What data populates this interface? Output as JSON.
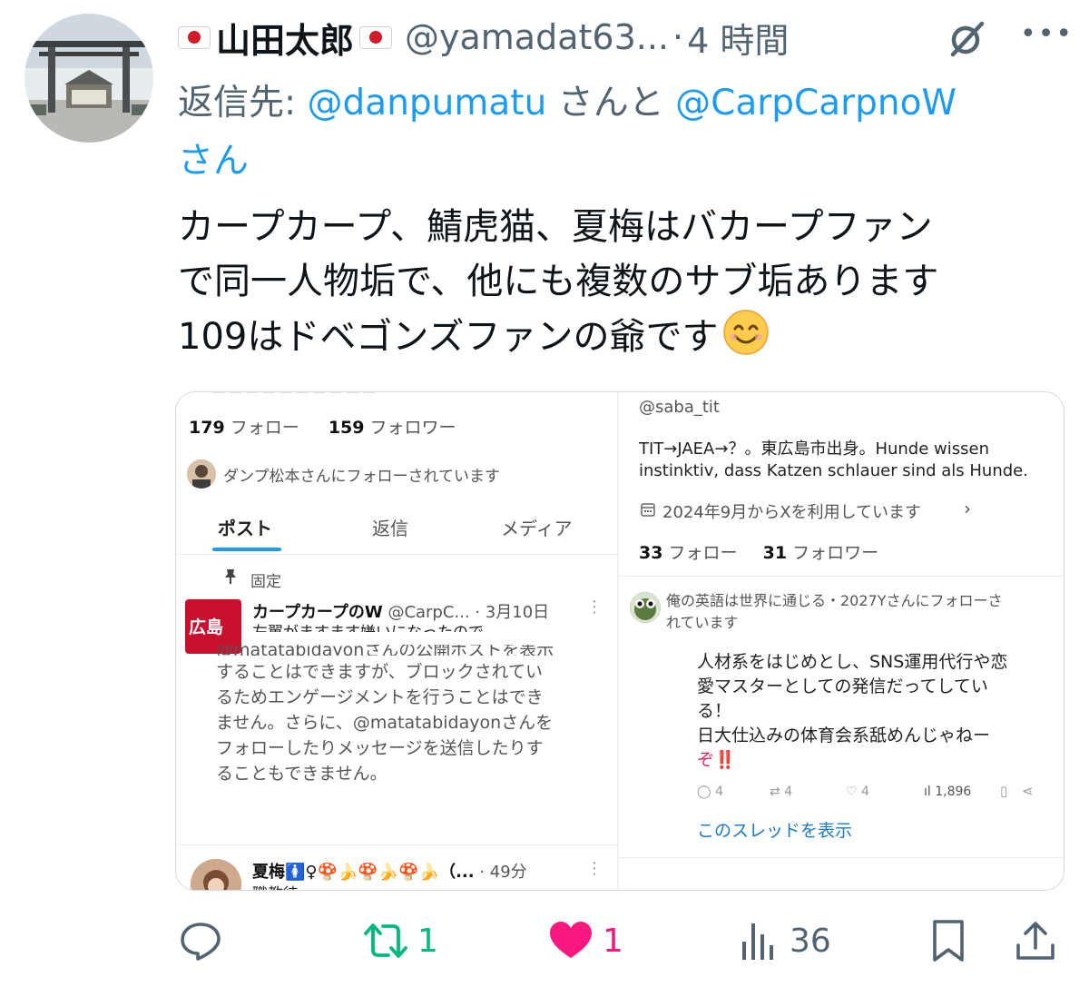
{
  "tweet": {
    "display_name": "山田太郎",
    "handle": "@yamadat63...",
    "separator": "·",
    "time": "4 時間",
    "reply_prefix": "返信先: ",
    "reply_mention_1": "@danpumatu",
    "reply_join": " さんと ",
    "reply_mention_2": "@CarpCarpnoW",
    "reply_suffix": " さん",
    "text": "カープカープ、鯖虎猫、夏梅はバカープファン\nで同一人物垢で、他にも複数のサブ垢あります\n109はドベゴンズファンの爺です"
  },
  "left_shot": {
    "follow_count": "179",
    "follow_label": " フォロー",
    "follower_count": "159",
    "follower_label": " フォロワー",
    "followed_by": "ダンプ松本さんにフォローされています",
    "tabs": [
      "ポスト",
      "返信",
      "メディア"
    ],
    "pinned_label": "固定",
    "pinned_badge": "広島",
    "pinned_author": "カープカープのW",
    "pinned_handle": "@CarpC...",
    "pinned_date": "· 3月10日",
    "pinned_text": "左翼がますます嫌いになったので",
    "blocked_top": "@matatabidayonさんの公開ポストを表示",
    "blocked_lines": [
      "することはできますが、ブロックされてい",
      "るためエンゲージメントを行うことはでき",
      "ません。さらに、@matatabidayonさんを",
      "フォローしたりメッセージを送信したりす",
      "ることもできません。"
    ],
    "bottom_author": "夏梅🚺♀🍄🍌🍄🍌🍄🍌（...",
    "bottom_time": "· 49分",
    "bottom_sub": "職教徒"
  },
  "right_shot": {
    "handle": "@saba_tit",
    "bio_line1": "TIT→JAEA→？。東広島市出身。Hunde wissen",
    "bio_line2": "instinktiv, dass Katzen schlauer sind als Hunde.",
    "joined": "2024年9月からXを利用しています",
    "follow_count": "33",
    "follow_label": " フォロー",
    "follower_count": "31",
    "follower_label": " フォロワー",
    "followed_by_1": "俺の英語は世界に通じる・2027Yさんにフォローさ",
    "followed_by_2": "れています",
    "post_lines": [
      "人材系をはじめとし、SNS運用代行や恋",
      "愛マスターとしての発信だってしてい",
      "る！",
      "日大仕込みの体育会系舐めんじゃねー",
      "ぞ‼️"
    ],
    "stat_reply": "4",
    "stat_retweet": "4",
    "stat_like": "4",
    "stat_views": "1,896",
    "thread_link": "このスレッドを表示"
  },
  "actions": {
    "retweets": "1",
    "likes": "1",
    "views": "36"
  },
  "colors": {
    "accent": "#1d9bf0",
    "retweet": "#00ba7c",
    "like": "#f91880",
    "muted": "#536471"
  }
}
